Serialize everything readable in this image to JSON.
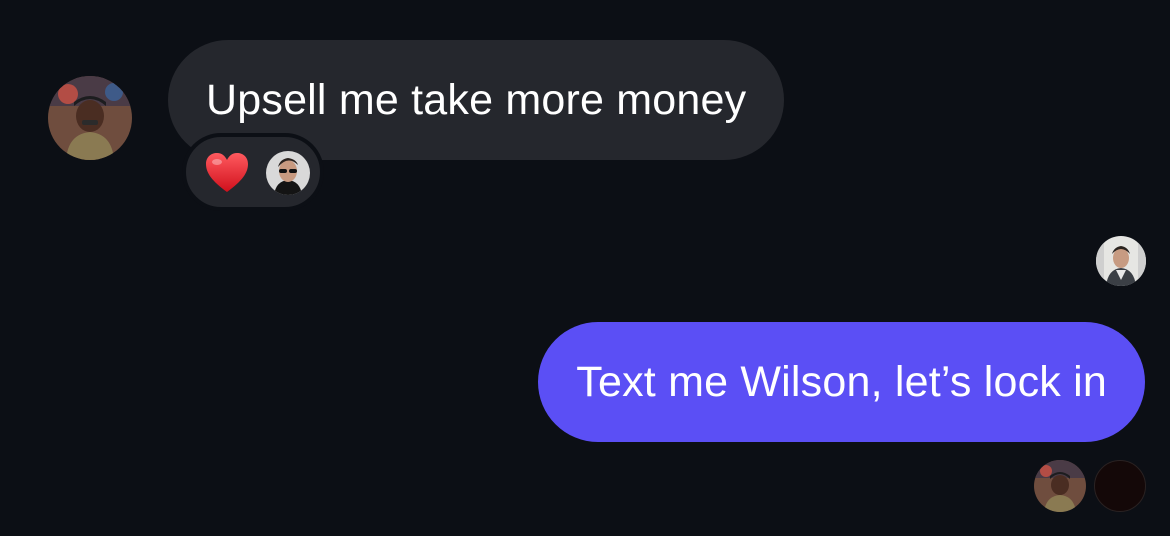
{
  "thread": {
    "incoming_message": {
      "text": "Upsell me take more money",
      "sender_avatar_icon": "user-avatar-photo-icon",
      "reaction": {
        "emoji": "❤️",
        "emoji_icon": "red-heart-icon",
        "reactor_avatar_icon": "reactor-avatar-photo-icon"
      }
    },
    "outgoing_message": {
      "text": "Text me Wilson, let’s lock in",
      "bubble_color": "#5b4ff5"
    },
    "read_receipts": [
      "seen-avatar-1-icon",
      "seen-avatar-2-icon"
    ],
    "typing_avatar_icon": "participant-avatar-icon"
  },
  "colors": {
    "background": "#0c0f15",
    "incoming_bubble": "#25272d",
    "outgoing_bubble": "#5b4ff5",
    "text": "#ffffff",
    "heart": "#e5202e"
  }
}
